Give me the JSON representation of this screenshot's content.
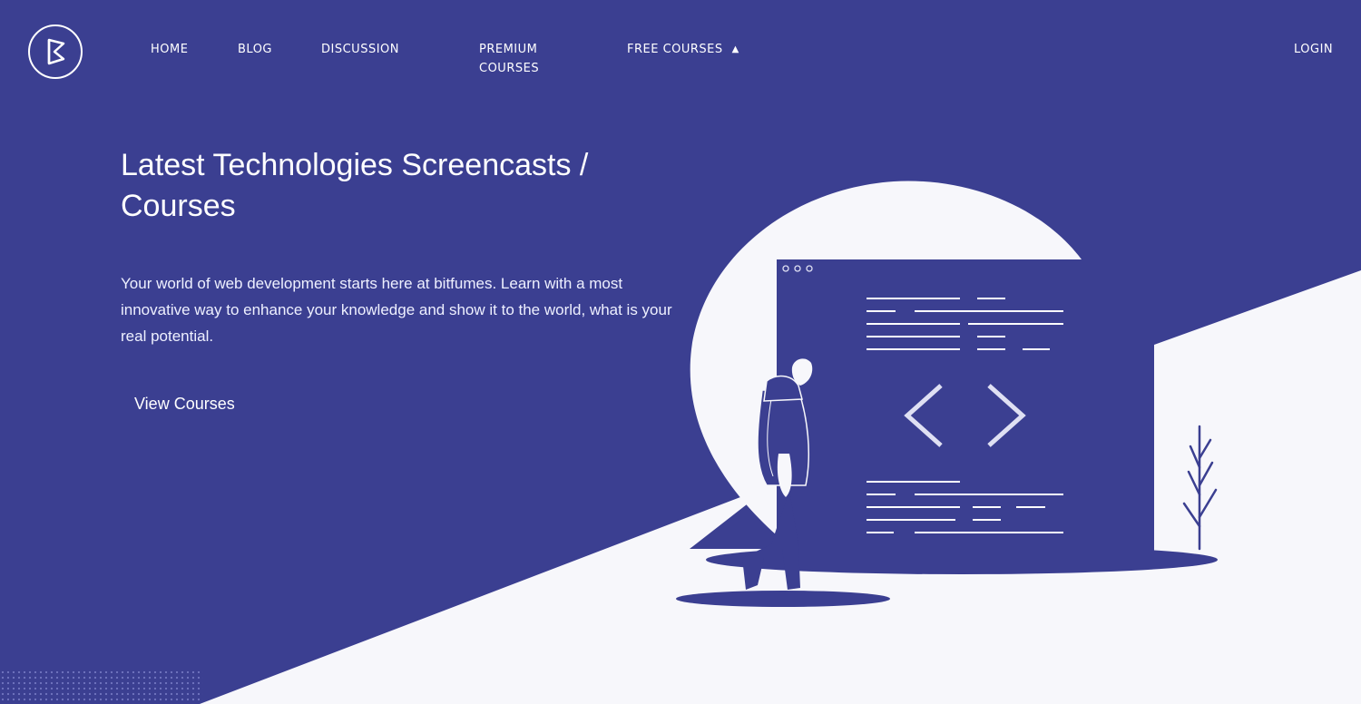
{
  "nav": {
    "logo_name": "bitfumes-logo-icon",
    "items": [
      {
        "label": "HOME"
      },
      {
        "label": "BLOG"
      },
      {
        "label": "DISCUSSION"
      },
      {
        "label": "PREMIUM COURSES"
      },
      {
        "label": "FREE COURSES",
        "caret": "▲"
      }
    ],
    "login": "LOGIN"
  },
  "hero": {
    "title": "Latest Technologies Screencasts / Courses",
    "description": "Your world of web development starts here at bitfumes. Learn with a most innovative way to enhance your knowledge and show it to the world, what is your real potential.",
    "cta_label": "View Courses"
  },
  "colors": {
    "background": "#3b3f91",
    "light": "#f7f7fb",
    "text": "#ffffff"
  },
  "illustration": {
    "icon": "code-brackets-icon",
    "figure": "person-illustration",
    "plant": "plant-icon"
  }
}
